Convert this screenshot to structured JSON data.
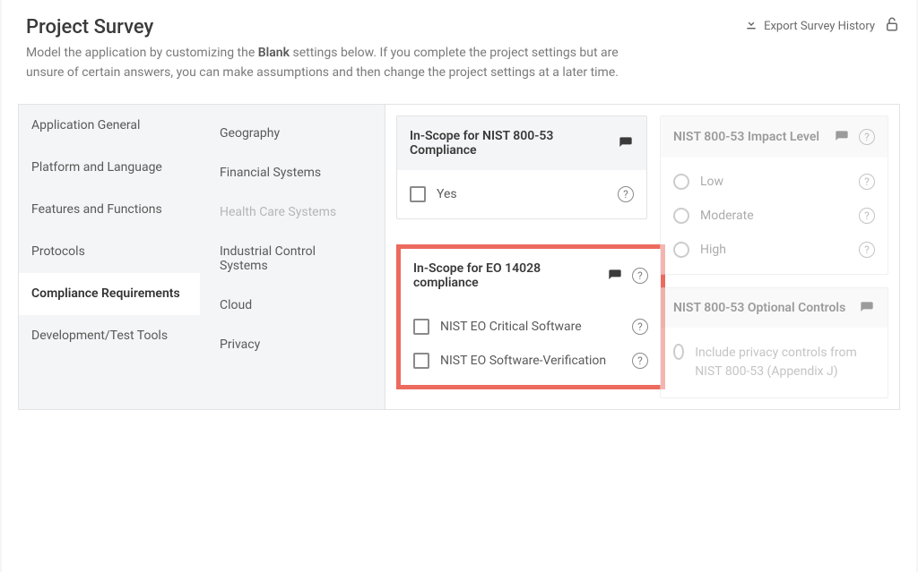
{
  "header": {
    "title": "Project Survey",
    "description_pre": "Model the application by customizing the ",
    "description_strong": "Blank",
    "description_post": " settings below. If you complete the project settings but are unsure of certain answers, you can make assumptions and then change the project settings at a later time.",
    "export_label": "Export Survey History"
  },
  "tier1": [
    "Application General",
    "Platform and Language",
    "Features and Functions",
    "Protocols",
    "Compliance Requirements",
    "Development/Test Tools"
  ],
  "tier2": [
    "Geography",
    "Financial Systems",
    "Health Care Systems",
    "Industrial Control Systems",
    "Cloud",
    "Privacy"
  ],
  "cards": {
    "inscope_nist": {
      "title": "In-Scope for NIST 800-53 Compliance",
      "options": [
        "Yes"
      ]
    },
    "impact_level": {
      "title": "NIST 800-53 Impact Level",
      "options": [
        "Low",
        "Moderate",
        "High"
      ]
    },
    "optional_controls": {
      "title": "NIST 800-53 Optional Controls",
      "options": [
        "Include privacy controls from NIST 800-53 (Appendix J)"
      ]
    },
    "eo14028": {
      "title": "In-Scope for EO 14028 compliance",
      "options": [
        "NIST EO Critical Software",
        "NIST EO Software-Verification"
      ]
    }
  }
}
